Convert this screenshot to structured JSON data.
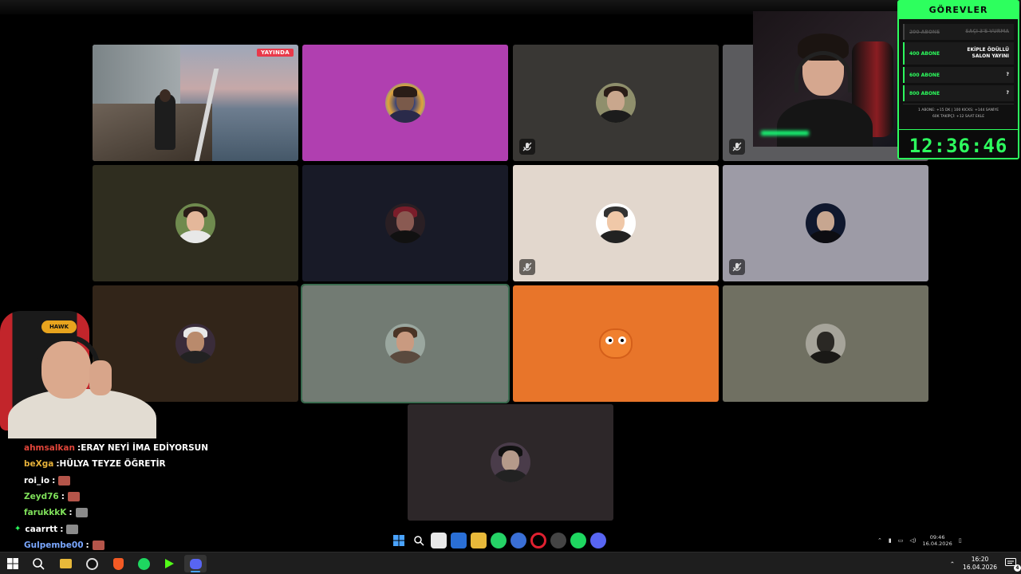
{
  "game_tile": {
    "live_label": "YAYINDA"
  },
  "tasks_panel": {
    "title": "GÖREVLER",
    "items": [
      {
        "goal": "200 ABONE",
        "reward": "SAÇI 3'E VURMA",
        "done": true
      },
      {
        "goal": "400 ABONE",
        "reward": "EKİPLE ÖDÜLLÜ SALON YAYINI",
        "done": false
      },
      {
        "goal": "600 ABONE",
        "reward": "?",
        "done": false
      },
      {
        "goal": "800 ABONE",
        "reward": "?",
        "done": false
      }
    ],
    "rules_line1": "1 ABONE: +15 DK | 100 KICKS: +144 SANİYE",
    "rules_line2": "60K TAKİPÇİ: +12 SAAT EKLE",
    "timer": "12:36:46"
  },
  "cam_left": {
    "chair_logo": "HAWK"
  },
  "chat": [
    {
      "user": "ahmsalkan",
      "user_color": "#e0453a",
      "message": "ERAY NEYİ İMA EDİYORSUN",
      "emote": false
    },
    {
      "user": "beXga",
      "user_color": "#e7b23a",
      "message": "HÜLYA TEYZE ÖĞRETİR",
      "emote": false
    },
    {
      "user": "roi_io",
      "user_color": "#ffffff",
      "message": "",
      "emote": true,
      "emote_color": "#b4554a"
    },
    {
      "user": "Zeyd76",
      "user_color": "#7fe05a",
      "message": "",
      "emote": true,
      "emote_color": "#b4554a"
    },
    {
      "user": "farukkkK",
      "user_color": "#7fe05a",
      "message": "",
      "emote": true,
      "emote_color": "#8a8a8a"
    },
    {
      "user": "caarrtt",
      "user_color": "#ffffff",
      "message": "",
      "emote": true,
      "emote_color": "#8a8a8a",
      "badge": "✦"
    },
    {
      "user": "Gulpembe00",
      "user_color": "#7aa7ff",
      "message": "",
      "emote": true,
      "emote_color": "#b4554a"
    }
  ],
  "inner_tray": {
    "time": "09:46",
    "date": "16.04.2026"
  },
  "taskbar": {
    "time": "16:20",
    "date": "16.04.2026",
    "notifications": "4"
  },
  "colors": {
    "accent": "#2dff5e",
    "live": "#e9394a",
    "tile_orange": "#e8752a",
    "tile_magenta": "#b03fb0"
  }
}
